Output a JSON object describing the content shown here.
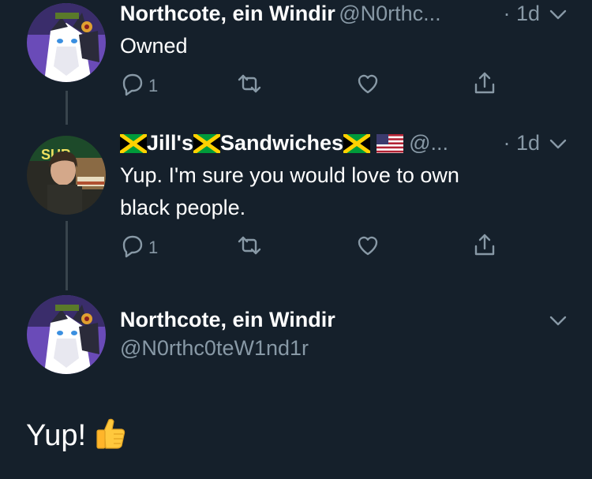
{
  "tweet1": {
    "display_name": "Northcote, ein Windir",
    "handle": "@N0rthc...",
    "time": "· 1d",
    "text": "Owned",
    "reply_count": "1"
  },
  "tweet2": {
    "name_part1": "Jill's",
    "name_part2": "Sandwiches",
    "handle": "@...",
    "time": "· 1d",
    "text_line1": "Yup. I'm sure you would love to own",
    "text_line2": "black people.",
    "reply_count": "1"
  },
  "tweet3": {
    "display_name": "Northcote, ein Windir",
    "handle": "@N0rthc0teW1nd1r",
    "text": "Yup!",
    "emoji": "👍"
  },
  "colors": {
    "background": "#15202b",
    "secondary_text": "#8899a6",
    "thread_line": "#38444d"
  },
  "icons": [
    "reply-icon",
    "retweet-icon",
    "like-icon",
    "share-icon",
    "chevron-down-icon",
    "jamaica-flag-icon",
    "us-flag-icon",
    "thumbs-up-emoji"
  ]
}
